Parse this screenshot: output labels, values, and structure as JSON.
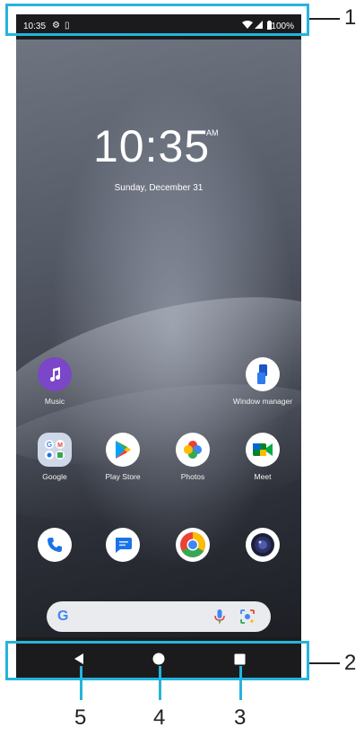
{
  "status_bar": {
    "time": "10:35",
    "battery": "100%"
  },
  "clock": {
    "time": "10:35",
    "ampm": "AM",
    "date": "Sunday, December 31"
  },
  "apps": {
    "music": "Music",
    "window_manager": "Window manager",
    "google": "Google",
    "play_store": "Play Store",
    "photos": "Photos",
    "meet": "Meet"
  },
  "callouts": {
    "status_bar": "1",
    "nav_bar": "2",
    "recents": "3",
    "home": "4",
    "back": "5"
  },
  "colors": {
    "callout_line": "#25b4dc",
    "music_icon": "#7b46c8",
    "phone_icon": "#1a73e8"
  },
  "icons": {
    "back": "back-triangle-icon",
    "home": "home-circle-icon",
    "recents": "recents-square-icon"
  }
}
